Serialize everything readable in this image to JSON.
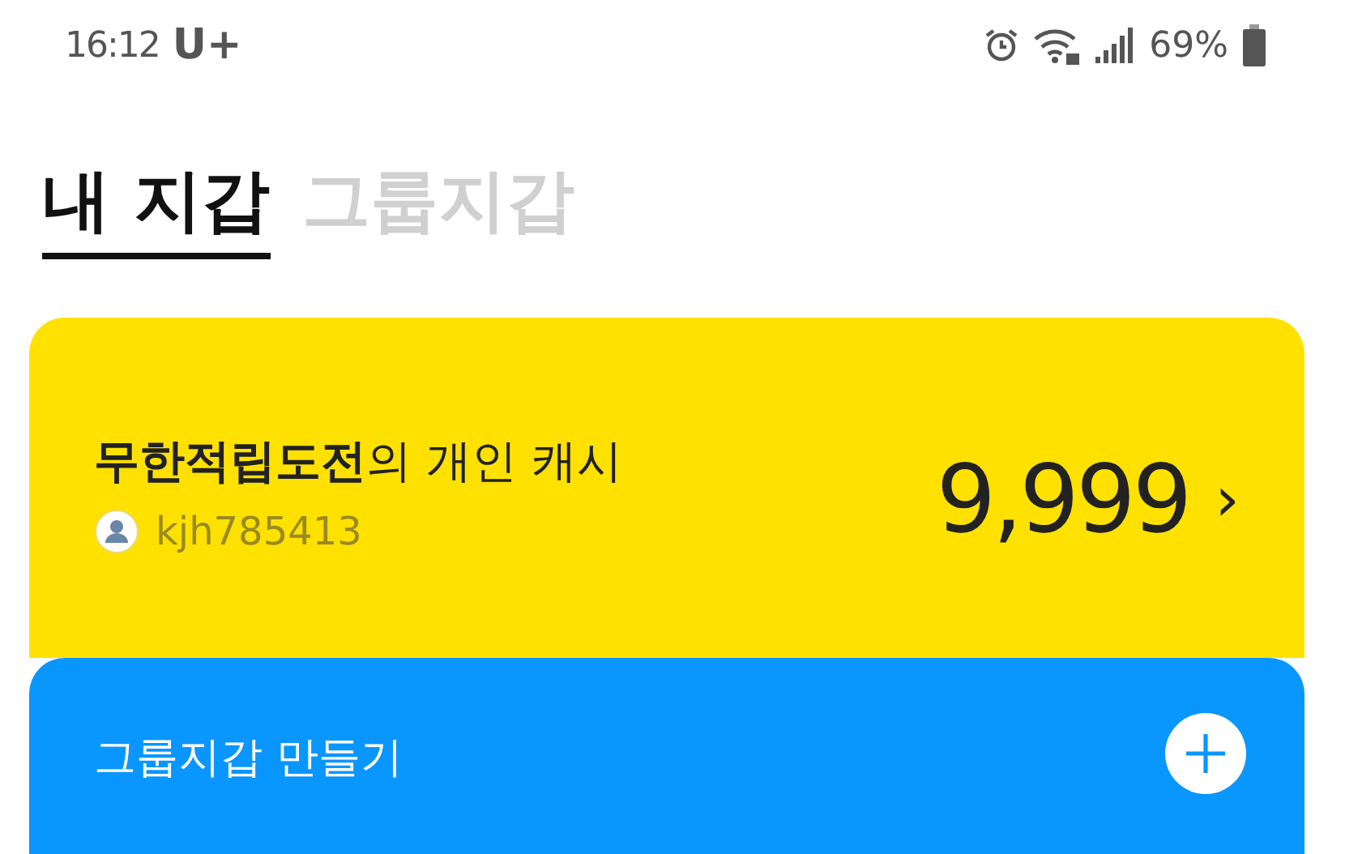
{
  "status_bar": {
    "time": "16:12",
    "carrier": "U+",
    "battery": "69%"
  },
  "tabs": [
    {
      "label": "내 지갑",
      "selected": true
    },
    {
      "label": "그룹지갑",
      "selected": false
    }
  ],
  "wallet_card": {
    "title": "**무한적립도전**의 개인 캐시",
    "user_id": "kjh785413",
    "amount": "9,999",
    "chevron": "›"
  },
  "group_card": {
    "label": "그룹지갑 만들기"
  }
}
